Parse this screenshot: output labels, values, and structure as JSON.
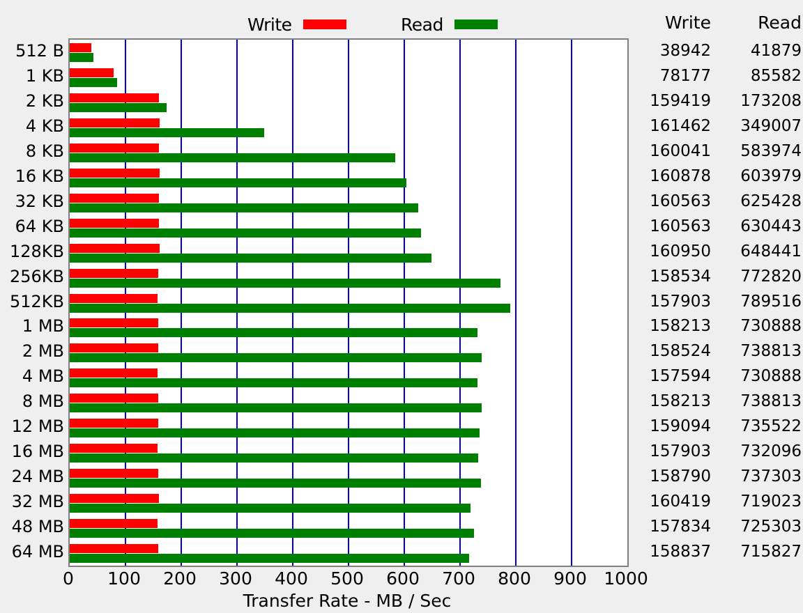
{
  "legend": {
    "write_label": "Write",
    "read_label": "Read",
    "write_color": "#ff0000",
    "read_color": "#008000"
  },
  "table": {
    "write_header": "Write",
    "read_header": "Read"
  },
  "axis": {
    "title": "Transfer Rate - MB / Sec",
    "ticks": [
      "0",
      "100",
      "200",
      "300",
      "400",
      "500",
      "600",
      "700",
      "800",
      "900",
      "1000"
    ]
  },
  "colors": {
    "background": "#efefef",
    "plot_background": "#ffffff",
    "plot_border": "#808080",
    "gridline": "#0000cc",
    "write": "#ff0000",
    "read": "#008000"
  },
  "chart_data": {
    "type": "bar",
    "orientation": "horizontal",
    "title": "",
    "xlabel": "Transfer Rate - MB / Sec",
    "ylabel": "",
    "xlim": [
      0,
      1000
    ],
    "grid": true,
    "gridline_step": 100,
    "legend_position": "top",
    "categories": [
      "512 B",
      "1 KB",
      "2 KB",
      "4 KB",
      "8 KB",
      "16 KB",
      "32 KB",
      "64 KB",
      "128KB",
      "256KB",
      "512KB",
      "1 MB",
      "2 MB",
      "4 MB",
      "8 MB",
      "12 MB",
      "16 MB",
      "24 MB",
      "32 MB",
      "48 MB",
      "64 MB"
    ],
    "series": [
      {
        "name": "Write",
        "color": "#ff0000",
        "values": [
          38942,
          78177,
          159419,
          161462,
          160041,
          160878,
          160563,
          160563,
          160950,
          158534,
          157903,
          158213,
          158524,
          157594,
          158213,
          159094,
          157903,
          158790,
          160419,
          157834,
          158837
        ]
      },
      {
        "name": "Read",
        "color": "#008000",
        "values": [
          41879,
          85582,
          173208,
          349007,
          583974,
          603979,
          625428,
          630443,
          648441,
          772820,
          789516,
          730888,
          738813,
          730888,
          738813,
          735522,
          732096,
          737303,
          719023,
          725303,
          715827
        ]
      }
    ],
    "value_unit": "KB/Sec displayed in table; bars plotted as MB/Sec (value/1000)"
  }
}
